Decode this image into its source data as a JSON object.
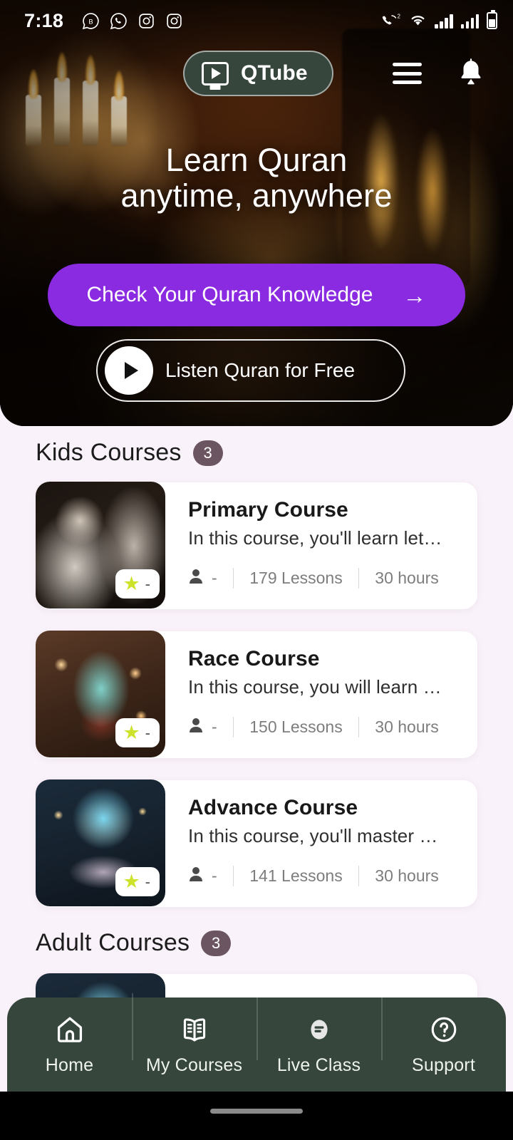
{
  "status_bar": {
    "time": "7:18",
    "left_icons": [
      "whatsapp-business-icon",
      "whatsapp-icon",
      "instagram-icon",
      "instagram-icon"
    ],
    "right_icons": [
      "call-forward-2-icon",
      "wifi-icon",
      "signal-icon",
      "signal-icon",
      "battery-icon"
    ]
  },
  "app_bar": {
    "logo_text": "QTube",
    "logo_icon": "video-play-icon",
    "menu_icon": "hamburger-menu-icon",
    "bell_icon": "notification-bell-icon"
  },
  "hero": {
    "title_line1": "Learn Quran",
    "title_line2": "anytime, anywhere",
    "primary_button": {
      "label": "Check Your Quran Knowledge",
      "arrow": "→"
    },
    "secondary_button": {
      "label": "Listen Quran for Free",
      "icon": "play-icon"
    }
  },
  "sections": [
    {
      "title": "Kids Courses",
      "count": "3",
      "courses": [
        {
          "title": "Primary Course",
          "description": "In this course, you'll learn let…",
          "students": "-",
          "lessons": "179 Lessons",
          "duration": "30 hours",
          "rating": "-",
          "star_glyph": "★"
        },
        {
          "title": "Race Course",
          "description": "In this course, you will learn …",
          "students": "-",
          "lessons": "150 Lessons",
          "duration": "30 hours",
          "rating": "-",
          "star_glyph": "★"
        },
        {
          "title": "Advance Course",
          "description": "In this course, you'll master …",
          "students": "-",
          "lessons": "141 Lessons",
          "duration": "30 hours",
          "rating": "-",
          "star_glyph": "★"
        }
      ]
    },
    {
      "title": "Adult Courses",
      "count": "3"
    }
  ],
  "bottom_nav": {
    "items": [
      {
        "label": "Home",
        "icon": "home-icon",
        "active": true
      },
      {
        "label": "My Courses",
        "icon": "open-book-icon",
        "active": false
      },
      {
        "label": "Live Class",
        "icon": "live-class-icon",
        "active": false
      },
      {
        "label": "Support",
        "icon": "question-circle-icon",
        "active": false
      }
    ]
  },
  "colors": {
    "accent_purple": "#8a2be2",
    "nav_green": "#36463c",
    "page_background": "#faf2fa",
    "badge_mauve": "#6b5560",
    "star_yellow": "#cde22a"
  }
}
